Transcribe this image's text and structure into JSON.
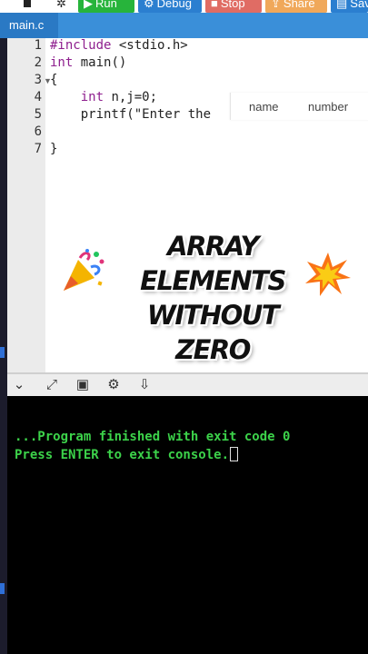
{
  "toolbar": {
    "run_label": "Run",
    "debug_label": "Debug",
    "stop_label": "Stop",
    "share_label": "Share",
    "save_label": "Save",
    "colors": {
      "run": "#27b43b",
      "debug": "#2b7fd0",
      "stop": "#e06c64",
      "share": "#f0a85a",
      "save": "#2b7fd0"
    }
  },
  "tabs": [
    {
      "label": "main.c"
    }
  ],
  "editor": {
    "lines": [
      {
        "num": "1",
        "text": "#include <stdio.h>"
      },
      {
        "num": "2",
        "text": "int main()"
      },
      {
        "num": "3",
        "text": "{"
      },
      {
        "num": "4",
        "text": "    int n,j=0;"
      },
      {
        "num": "5",
        "text": "    printf(\"Enter the "
      },
      {
        "num": "6",
        "text": ""
      },
      {
        "num": "7",
        "text": "}"
      }
    ]
  },
  "autocomplete": {
    "col1": "name",
    "col2": "number"
  },
  "overlay": {
    "title_line1": "ARRAY ELEMENTS",
    "title_line2": "WITHOUT ZERO"
  },
  "console": {
    "lines": [
      "...Program finished with exit code 0",
      "Press ENTER to exit console."
    ]
  }
}
